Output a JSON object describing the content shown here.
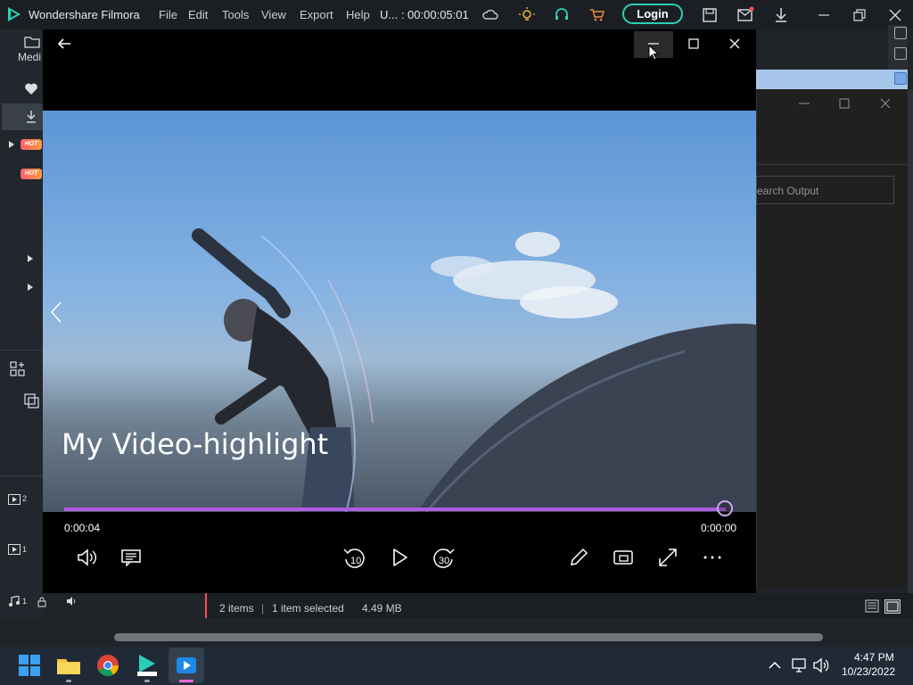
{
  "app": {
    "title": "Wondershare Filmora",
    "menu": [
      "File",
      "Edit",
      "Tools",
      "View",
      "Export",
      "Help"
    ],
    "project_time": "U... : 00:00:05:01",
    "login_label": "Login",
    "accent_color": "#2ad0b5"
  },
  "sidebar": {
    "media_label": "Medi",
    "hot_badge": "HOT"
  },
  "background_window": {
    "search_placeholder": "earch Output"
  },
  "player": {
    "video_title": "My Video-highlight",
    "time_elapsed": "0:00:04",
    "time_remaining": "0:00:00",
    "progress_fraction": 1.0,
    "skip_back_seconds": "10",
    "skip_forward_seconds": "30",
    "progress_color": "#b05ce0"
  },
  "statusbar": {
    "items": "2 items",
    "selected": "1 item selected",
    "size": "4.49 MB"
  },
  "timeline": {
    "track_video2": "2",
    "track_video1": "1",
    "track_audio1": "1"
  },
  "taskbar": {
    "time": "4:47 PM",
    "date": "10/23/2022"
  }
}
